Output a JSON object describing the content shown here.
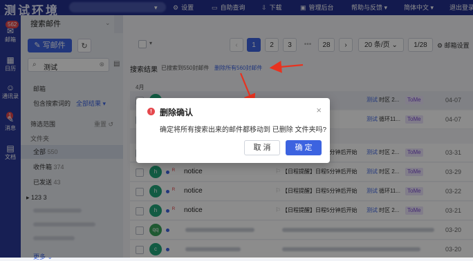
{
  "app": {
    "brand": "测试环境",
    "unread_badge": "562",
    "nav": {
      "settings": "设置",
      "auto_query": "自助查询",
      "download": "下载",
      "admin": "管理后台",
      "help": "帮助与反馈",
      "language": "简体中文",
      "logout": "退出登录"
    }
  },
  "sidebar": {
    "mail": "邮箱",
    "calendar": "日历",
    "contacts": "通讯录",
    "messages": "消息",
    "messages_badge": "1",
    "docs": "文档"
  },
  "folder_pane": {
    "tab_label": "搜索邮件",
    "compose_label": "写邮件",
    "search_value": "测试",
    "mailbox_label": "邮箱",
    "scope_label": "包含搜索词的",
    "scope_value": "全部结果",
    "filter_label": "筛选范围",
    "reset_label": "重置",
    "folders_label": "文件夹",
    "folders": [
      {
        "name": "全部",
        "count": "550",
        "active": true
      },
      {
        "name": "收件箱",
        "count": "374",
        "active": false
      },
      {
        "name": "已发送",
        "count": "43",
        "active": false
      },
      {
        "name": "123",
        "count": "3",
        "active": false
      }
    ],
    "more_label": "更多"
  },
  "toolbar": {
    "pages": [
      "1",
      "2",
      "3",
      "•••",
      "28"
    ],
    "current_page": "1",
    "per_page": "20 条/页",
    "page_indicator": "1/28",
    "mail_settings": "邮箱设置"
  },
  "results": {
    "label": "搜索结果",
    "found_text": "已搜索到550封邮件",
    "delete_all_link": "删除所有560封邮件",
    "month_label": "4月"
  },
  "rows": [
    {
      "avatar": "",
      "sender": "",
      "subject": "",
      "tag": "测试",
      "mid": "时区 2...",
      "tome": "ToMe",
      "date": "04-07"
    },
    {
      "avatar": "",
      "sender": "",
      "subject": "",
      "tag": "测试",
      "mid": "循环11...",
      "tome": "ToMe",
      "date": "04-07"
    },
    {
      "avatar": "",
      "sender": "",
      "subject": "【日程提醒】日程5分钟后开始",
      "tag": "测试",
      "mid": "时区 2...",
      "tome": "ToMe",
      "date": "03-31"
    },
    {
      "avatar": "h",
      "sender": "notice",
      "subject": "【日程提醒】日程5分钟后开始",
      "tag": "测试",
      "mid": "时区 2...",
      "tome": "ToMe",
      "date": "03-29"
    },
    {
      "avatar": "h",
      "sender": "notice",
      "subject": "【日程提醒】日程5分钟后开始",
      "tag": "测试",
      "mid": "循环11...",
      "tome": "ToMe",
      "date": "03-22"
    },
    {
      "avatar": "h",
      "sender": "notice",
      "subject": "【日程提醒】日程5分钟后开始",
      "tag": "测试",
      "mid": "时区 2...",
      "tome": "ToMe",
      "date": "03-21"
    },
    {
      "avatar": "qq",
      "sender": "",
      "subject": "",
      "tag": "",
      "mid": "",
      "tome": "",
      "date": "03-20"
    },
    {
      "avatar": "c",
      "sender": "",
      "subject": "",
      "tag": "",
      "mid": "",
      "tome": "",
      "date": "03-20"
    }
  ],
  "dialog": {
    "title": "删除确认",
    "message": "确定将所有搜索出来的邮件都移动到 已删除 文件夹吗?",
    "cancel": "取 消",
    "confirm": "确 定"
  },
  "colors": {
    "primary": "#3c63e0",
    "topbar": "#24318f",
    "sidenav": "#2b3a99",
    "warning": "#e5484d",
    "annotation_arrow": "#e8321f"
  }
}
